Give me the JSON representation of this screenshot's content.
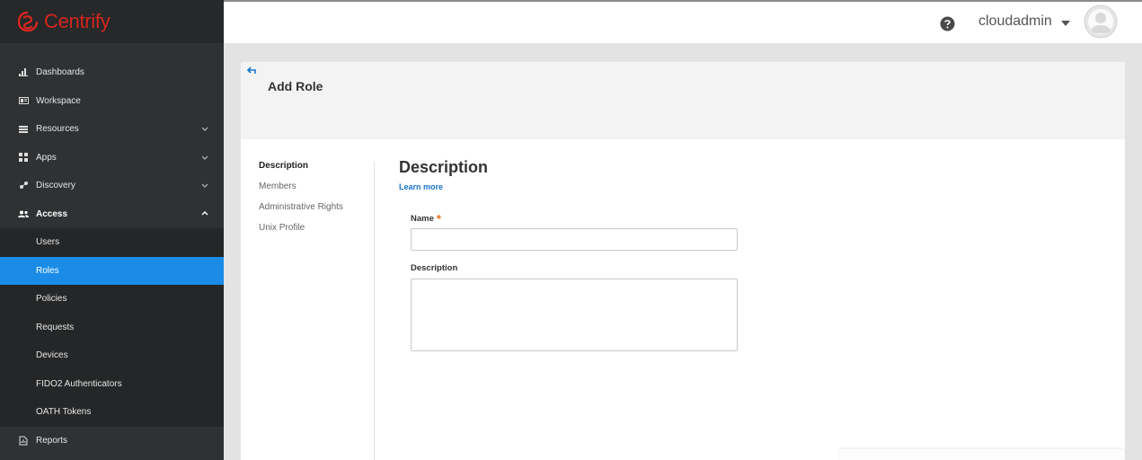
{
  "brand": {
    "name": "Centrify",
    "color": "#d6261f"
  },
  "header": {
    "help_icon": "question-circle-icon",
    "username": "cloudadmin",
    "avatar_icon": "user-avatar-icon"
  },
  "sidebar": {
    "items": [
      {
        "label": "Dashboards",
        "icon": "bar-chart-icon"
      },
      {
        "label": "Workspace",
        "icon": "workspace-icon"
      },
      {
        "label": "Resources",
        "icon": "list-icon",
        "expandable": true
      },
      {
        "label": "Apps",
        "icon": "grid-icon",
        "expandable": true
      },
      {
        "label": "Discovery",
        "icon": "discovery-icon",
        "expandable": true
      },
      {
        "label": "Access",
        "icon": "users-icon",
        "expanded": true
      }
    ],
    "access_subitems": [
      {
        "label": "Users"
      },
      {
        "label": "Roles",
        "selected": true
      },
      {
        "label": "Policies"
      },
      {
        "label": "Requests"
      },
      {
        "label": "Devices"
      },
      {
        "label": "FIDO2 Authenticators"
      },
      {
        "label": "OATH Tokens"
      }
    ],
    "reports": {
      "label": "Reports",
      "icon": "reports-icon"
    },
    "selected_color": "#1a8ce8"
  },
  "page": {
    "title": "Add Role",
    "steps": [
      "Description",
      "Members",
      "Administrative Rights",
      "Unix Profile"
    ],
    "current_step": "Description",
    "section_title": "Description",
    "learn_more": "Learn more",
    "name_label": "Name",
    "required_mark": "*",
    "name_value": "",
    "description_label": "Description",
    "description_value": ""
  }
}
